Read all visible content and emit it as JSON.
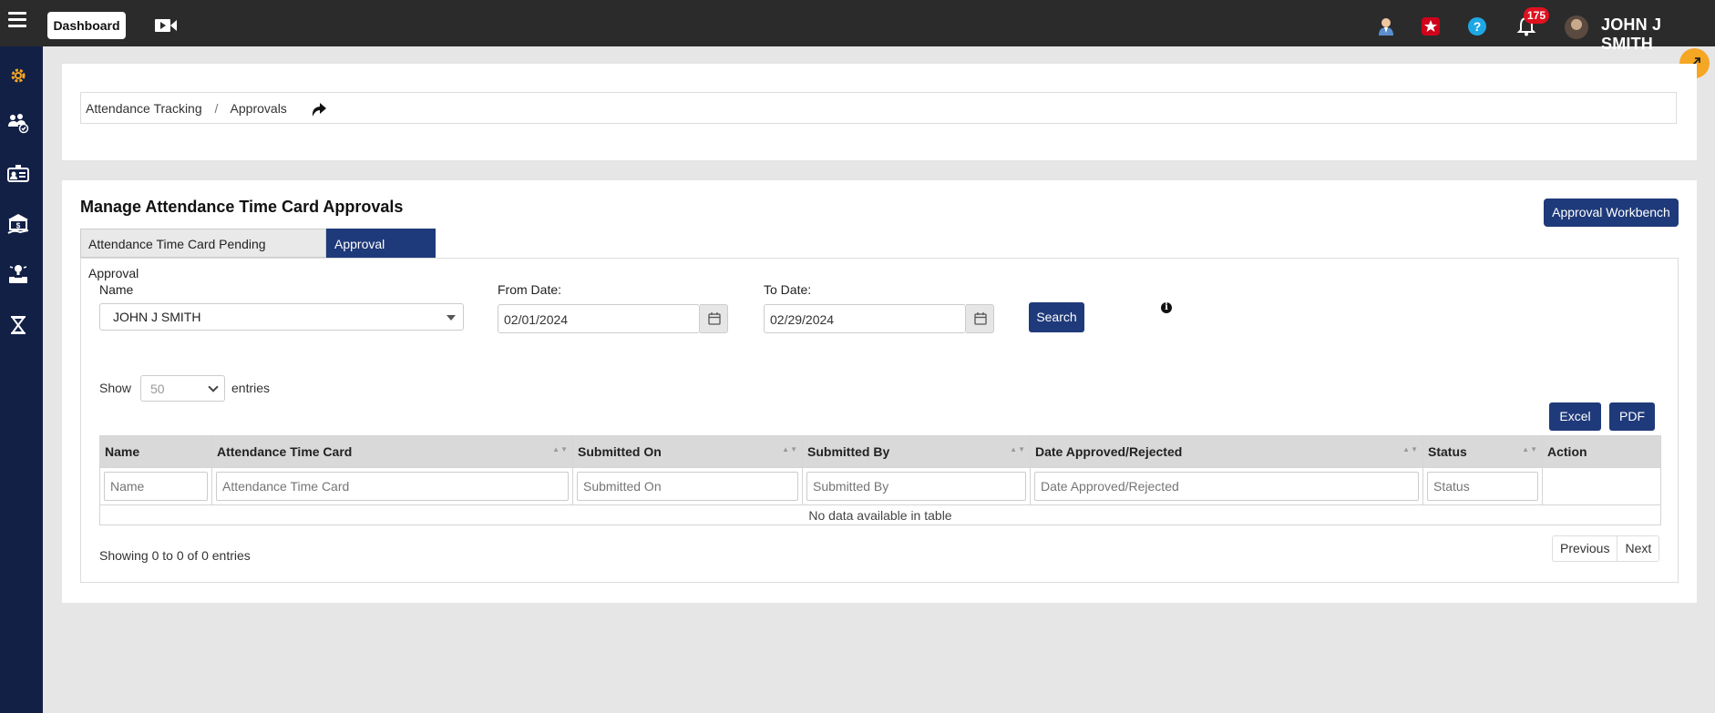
{
  "topbar": {
    "dashboard_label": "Dashboard",
    "notification_count": "175",
    "user_name": "JOHN J SMITH",
    "icons": [
      "menu-icon",
      "video-icon",
      "profile-icon",
      "favorites-star-icon",
      "help-icon",
      "bell-icon"
    ]
  },
  "sidebar": {
    "icons": [
      "gear-icon",
      "team-icon",
      "id-card-icon",
      "bank-icon",
      "ideas-icon",
      "hourglass-icon"
    ]
  },
  "breadcrumb": {
    "items": [
      "Attendance Tracking",
      "Approvals"
    ],
    "separator": "/"
  },
  "page": {
    "title": "Manage Attendance Time Card Approvals",
    "workbench_label": "Approval Workbench",
    "tabs": [
      {
        "label": "Attendance Time Card Pending Approval",
        "active": false
      },
      {
        "label": "Approval History",
        "active": true
      }
    ]
  },
  "filters": {
    "name_label": "Name",
    "name_value": "JOHN J SMITH",
    "from_label": "From Date:",
    "from_value": "02/01/2024",
    "to_label": "To Date:",
    "to_value": "02/29/2024",
    "search_label": "Search"
  },
  "table_controls": {
    "show_label": "Show",
    "entries_value": "50",
    "entries_label": "entries",
    "excel_label": "Excel",
    "pdf_label": "PDF"
  },
  "table": {
    "columns": [
      "Name",
      "Attendance Time Card",
      "Submitted On",
      "Submitted By",
      "Date Approved/Rejected",
      "Status",
      "Action"
    ],
    "filter_placeholders": [
      "Name",
      "Attendance Time Card",
      "Submitted On",
      "Submitted By",
      "Date Approved/Rejected",
      "Status"
    ],
    "empty_message": "No data available in table",
    "info": "Showing 0 to 0 of 0 entries",
    "prev_label": "Previous",
    "next_label": "Next"
  },
  "colors": {
    "primary": "#1f3a7a",
    "sidebar": "#122046",
    "topbar": "#2b2b2b",
    "accent": "#f5a623",
    "badge": "#e0111f"
  }
}
